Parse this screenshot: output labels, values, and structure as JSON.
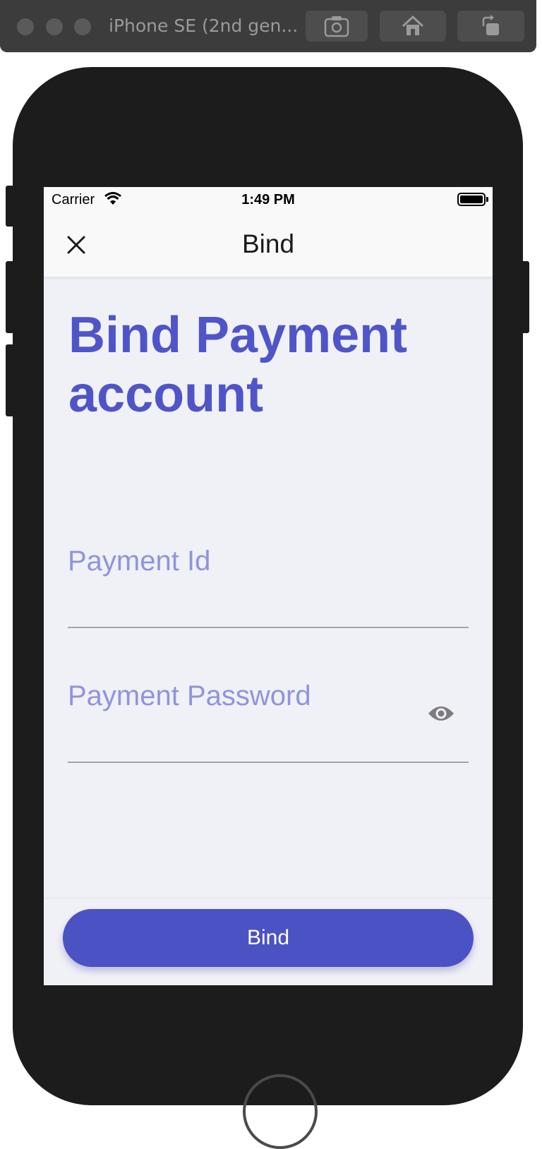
{
  "simulator": {
    "device_name": "iPhone SE (2nd gen...",
    "buttons": [
      "screenshot-icon",
      "home-icon",
      "rotate-icon"
    ]
  },
  "status_bar": {
    "carrier": "Carrier",
    "time": "1:49 PM"
  },
  "nav": {
    "title": "Bind",
    "close_icon": "close-icon"
  },
  "heading": "Bind Payment account",
  "form": {
    "payment_id": {
      "label": "Payment Id",
      "value": ""
    },
    "payment_password": {
      "label": "Payment Password",
      "value": "",
      "toggle_icon": "eye-icon"
    }
  },
  "footer": {
    "button_label": "Bind"
  },
  "colors": {
    "accent": "#4f55c8",
    "label": "#8f94dc",
    "button": "#4a52c4",
    "screen_bg": "#f0f1f6"
  }
}
